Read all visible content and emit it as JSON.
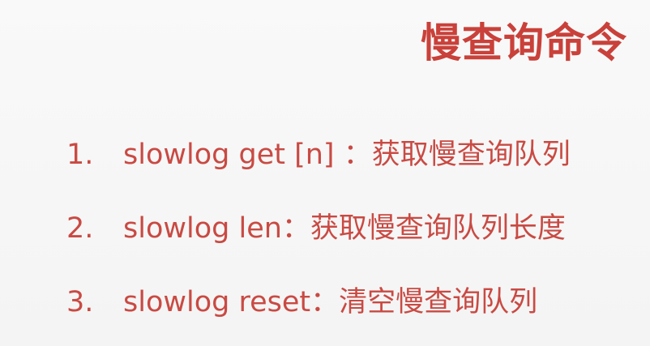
{
  "slide": {
    "title": "慢查询命令",
    "items": [
      {
        "number": "1.",
        "text": "slowlog get [n] ：获取慢查询队列"
      },
      {
        "number": "2.",
        "text": "slowlog len：获取慢查询队列长度"
      },
      {
        "number": "3.",
        "text": "slowlog reset：清空慢查询队列"
      }
    ]
  },
  "colors": {
    "title": "#c9413a",
    "body": "#c94a43",
    "background": "#f7f7f7"
  }
}
